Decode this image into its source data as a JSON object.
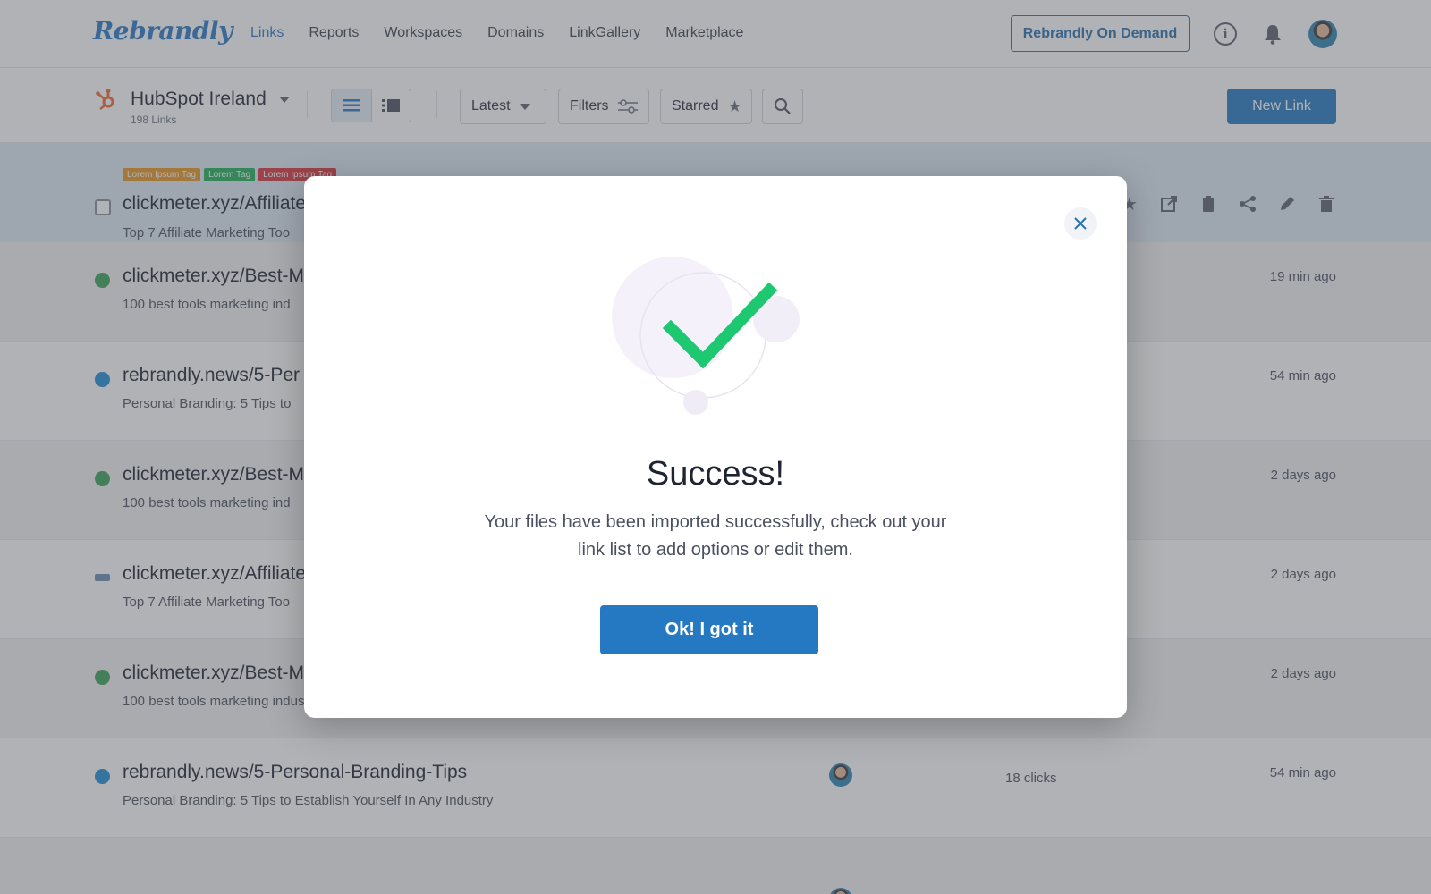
{
  "app": {
    "logo_text": "Rebrandly"
  },
  "nav": {
    "links": [
      "Links",
      "Reports",
      "Workspaces",
      "Domains",
      "LinkGallery",
      "Marketplace"
    ],
    "active": "Links",
    "on_demand_button": "Rebrandly On Demand"
  },
  "toolbar": {
    "workspace_name": "HubSpot Ireland",
    "workspace_count": "198 Links",
    "sort_label": "Latest",
    "filters_label": "Filters",
    "starred_label": "Starred",
    "new_link_label": "New Link"
  },
  "tags": [
    {
      "label": "Lorem Ipsum Tag",
      "color": "#e8961f"
    },
    {
      "label": "Lorem Tag",
      "color": "#20b15a"
    },
    {
      "label": "Lorem Ipsum Tag",
      "color": "#d9363e"
    }
  ],
  "links": [
    {
      "url": "clickmeter.xyz/Affiliate",
      "desc": "Top 7 Affiliate Marketing Too",
      "time": "",
      "clicks": "",
      "favicon_color": "#ffffff"
    },
    {
      "url": "clickmeter.xyz/Best-M",
      "desc": "100 best tools marketing ind",
      "time": "19 min ago",
      "clicks": "",
      "favicon_color": "#3aa55a"
    },
    {
      "url": "rebrandly.news/5-Per",
      "desc": "Personal Branding: 5 Tips to",
      "time": "54 min ago",
      "clicks": "",
      "favicon_color": "#1f8fd6"
    },
    {
      "url": "clickmeter.xyz/Best-M",
      "desc": "100 best tools marketing ind",
      "time": "2 days ago",
      "clicks": "",
      "favicon_color": "#3aa55a"
    },
    {
      "url": "clickmeter.xyz/Affiliate",
      "desc": "Top 7 Affiliate Marketing Too",
      "time": "2 days ago",
      "clicks": "",
      "favicon_color": "#6a8fb5"
    },
    {
      "url": "clickmeter.xyz/Best-M",
      "desc": "100 best tools marketing industry",
      "time": "2 days ago",
      "clicks": "",
      "favicon_color": "#3aa55a"
    },
    {
      "url": "rebrandly.news/5-Personal-Branding-Tips",
      "desc": "Personal Branding: 5 Tips to Establish Yourself In Any Industry",
      "time": "54 min ago",
      "clicks": "18 clicks",
      "favicon_color": "#1f8fd6"
    }
  ],
  "modal": {
    "title": "Success!",
    "message": "Your files have been imported successfully, check out your link list to add options or edit them.",
    "ok_button": "Ok! I got it"
  },
  "colors": {
    "accent": "#2579c3",
    "check_green": "#1ec870"
  }
}
